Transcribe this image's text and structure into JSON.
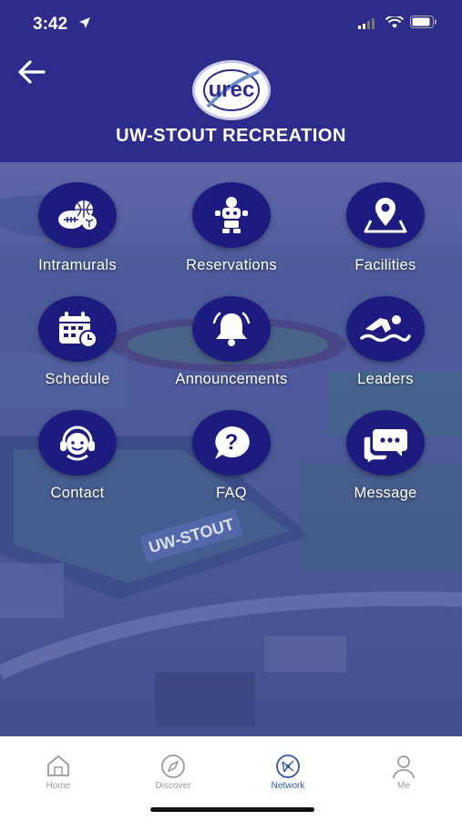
{
  "status_bar": {
    "time": "3:42"
  },
  "header": {
    "title": "UW-STOUT RECREATION",
    "logo_text": "urec"
  },
  "tiles": [
    {
      "label": "Intramurals",
      "icon": "sports-balls-icon"
    },
    {
      "label": "Reservations",
      "icon": "robot-icon"
    },
    {
      "label": "Facilities",
      "icon": "map-pin-icon"
    },
    {
      "label": "Schedule",
      "icon": "calendar-clock-icon"
    },
    {
      "label": "Announcements",
      "icon": "bell-icon"
    },
    {
      "label": "Leaders",
      "icon": "swimmer-icon"
    },
    {
      "label": "Contact",
      "icon": "headset-icon"
    },
    {
      "label": "FAQ",
      "icon": "question-bubble-icon"
    },
    {
      "label": "Message",
      "icon": "chat-bubbles-icon"
    }
  ],
  "background": {
    "field_text": "UW-STOUT"
  },
  "tabbar": {
    "items": [
      {
        "label": "Home",
        "icon": "home-icon"
      },
      {
        "label": "Discover",
        "icon": "compass-icon"
      },
      {
        "label": "Network",
        "icon": "network-icon",
        "active": true
      },
      {
        "label": "Me",
        "icon": "person-icon"
      }
    ]
  },
  "colors": {
    "header": "#2d2c8c",
    "tile_circle": "#1d1b80",
    "active_tab": "#2d56a8"
  }
}
